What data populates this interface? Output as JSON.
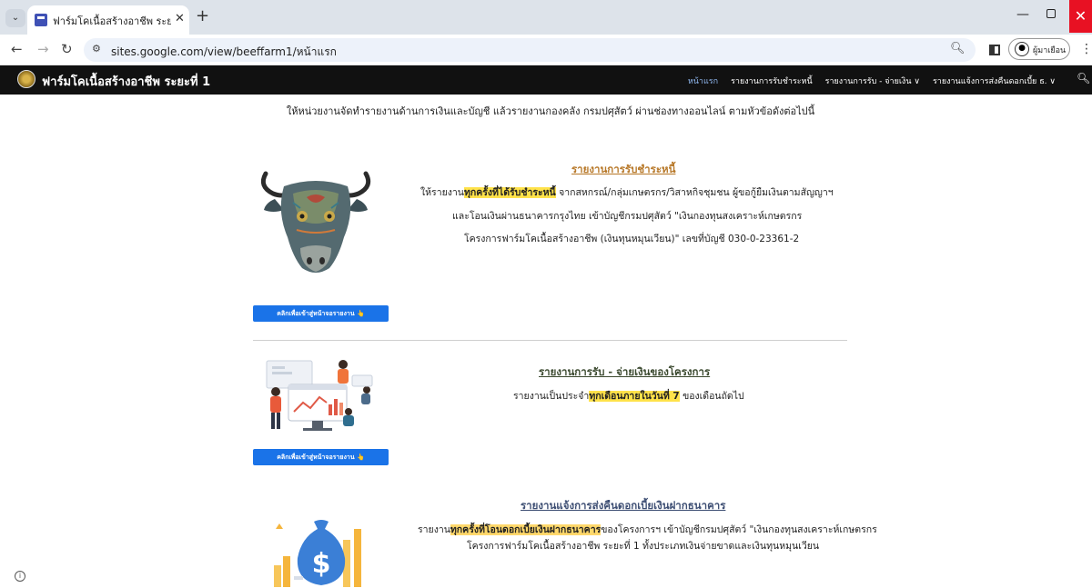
{
  "browser": {
    "tab_title": "ฟาร์มโคเนื้อสร้างอาชีพ ระยะที่ 1",
    "url": "sites.google.com/view/beeffarm1/หน้าแรก",
    "profile_label": "ผู้มาเยือน"
  },
  "site": {
    "title": "ฟาร์มโคเนื้อสร้างอาชีพ ระยะที่ 1",
    "nav": [
      {
        "label": "หน้าแรก",
        "active": true
      },
      {
        "label": "รายงานการรับชำระหนี้"
      },
      {
        "label": "รายงานการรับ - จ่ายเงิน ∨"
      },
      {
        "label": "รายงานแจ้งการส่งคืนดอกเบี้ย ธ. ∨"
      }
    ]
  },
  "intro": "ให้หน่วยงานจัดทำรายงานด้านการเงินและบัญชี แล้วรายงานกองคลัง กรมปศุสัตว์ ผ่านช่องทางออนไลน์ ตามหัวข้อดังต่อไปนี้",
  "sections": [
    {
      "title": "รายงานการรับชำระหนี้",
      "line1_pre": "ให้รายงาน",
      "line1_hl": "ทุกครั้งที่ได้รับชำระหนี้",
      "line1_post": " จากสหกรณ์/กลุ่มเกษตรกร/วิสาหกิจชุมชน ผู้ขอกู้ยืมเงินตามสัญญาฯ",
      "line2": "และโอนเงินผ่านธนาคารกรุงไทย  เข้าบัญชีกรมปศุสัตว์ \"เงินกองทุนสงเคราะห์เกษตรกร",
      "line3": "โครงการฟาร์มโคเนื้อสร้างอาชีพ (เงินทุนหมุนเวียน)\"  เลขที่บัญชี  030-0-23361-2",
      "button": "คลิกเพื่อเข้าสู่หน้าจอรายงาน 👆"
    },
    {
      "title": "รายงานการรับ - จ่ายเงินของโครงการ",
      "line1_pre": "รายงานเป็นประจำ",
      "line1_hl": "ทุกเดือนภายในวันที่ 7",
      "line1_post": " ของเดือนถัดไป",
      "button": "คลิกเพื่อเข้าสู่หน้าจอรายงาน 👆"
    },
    {
      "title": "รายงานแจ้งการส่งคืนดอกเบี้ยเงินฝากธนาคาร",
      "line1_pre": "รายงาน",
      "line1_hl": "ทุกครั้งที่โอนดอกเบี้ยเงินฝากธนาคาร",
      "line1_post": "ของโครงการฯ เข้าบัญชีกรมปศุสัตว์ \"เงินกองทุนสงเคราะห์เกษตรกร",
      "line2": "โครงการฟาร์มโคเนื้อสร้างอาชีพ ระยะที่ 1  ทั้งประเภทเงินจ่ายขาดและเงินทุนหมุนเวียน"
    }
  ]
}
